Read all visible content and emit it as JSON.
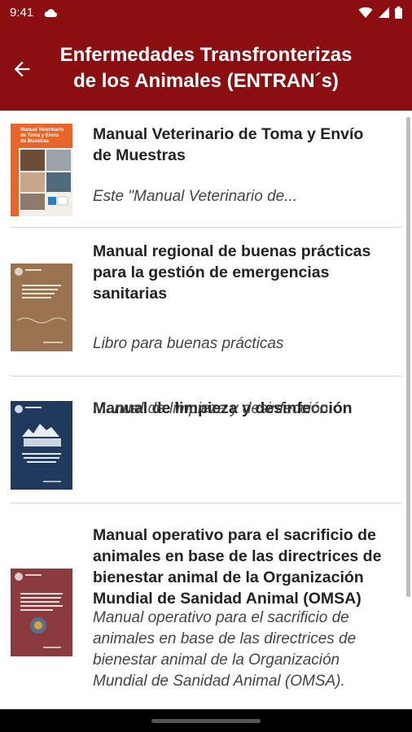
{
  "status_bar": {
    "time": "9:41",
    "icons": [
      "cloud-icon",
      "wifi-icon",
      "signal-icon",
      "battery-icon"
    ]
  },
  "app_bar": {
    "back_icon": "arrow-left-icon",
    "title_line1": "Enfermedades Transfronterizas",
    "title_line2": "de los Animales (ENTRAN´s)"
  },
  "items": [
    {
      "title_lines": [
        "Manual Veterinario de Toma y Envío",
        "de Muestras"
      ],
      "desc_lines": [
        "Este \"Manual Veterinario de..."
      ],
      "cover_text": [
        "Manual Veterinario",
        "de Toma y Envío",
        "de Muestras"
      ]
    },
    {
      "title_lines": [
        "Manual regional de buenas prácticas",
        "para la gestión de emergencias",
        "sanitarias"
      ],
      "desc_lines": [
        "Libro para buenas prácticas"
      ]
    },
    {
      "title_lines": [
        "Manual de limpieza y desinfección"
      ],
      "desc_lines": [
        "Manual de limpieza y desinfección."
      ]
    },
    {
      "title_lines": [
        "Manual operativo para el sacrificio de",
        "animales en base de las directrices de",
        "bienestar animal de la Organización",
        "Mundial de Sanidad Animal (OMSA)"
      ],
      "desc_lines": [
        "Manual operativo para el sacrificio de",
        "animales en base de las directrices de",
        "bienestar animal de la Organización",
        "Mundial de Sanidad Animal (OMSA)."
      ]
    }
  ],
  "colors": {
    "brand_red": "#8b0e10",
    "cover1": "#e8652a",
    "cover2": "#9b7250",
    "cover3": "#1f3a5c",
    "cover4": "#8b3a3e"
  }
}
